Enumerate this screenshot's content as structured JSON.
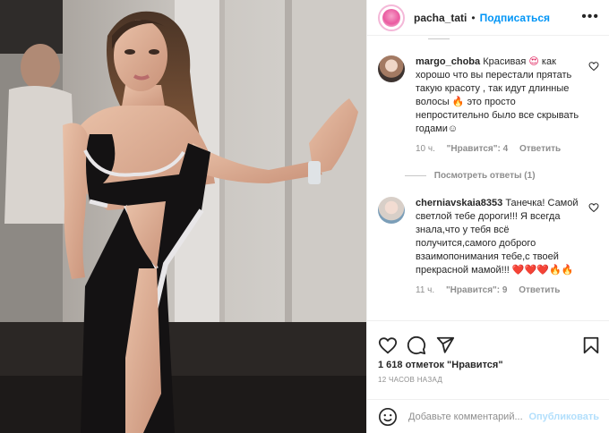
{
  "header": {
    "username": "pacha_tati",
    "separator": "•",
    "follow_label": "Подписаться"
  },
  "top_reply": {
    "text": ""
  },
  "comments": [
    {
      "username": "margo_choba",
      "text_a": "Красивая",
      "emoji_a": "😍",
      "text_b": "как хорошо что вы перестали прятать такую красоту , так идут длинные волосы",
      "emoji_b": "🔥",
      "text_c": "это просто непростительно было все скрывать годами☺",
      "time": "10 ч.",
      "likes": "\"Нравится\": 4",
      "reply": "Ответить",
      "view_replies": "Посмотреть ответы (1)"
    },
    {
      "username": "cherniavskaia8353",
      "text_a": "Танечка! Самой светлой тебе дороги!!! Я всегда знала,что у тебя всё получится,самого доброго взаимопонимания тебе,с твоей прекрасной мамой!!!",
      "emoji_a": "❤️❤️❤️🔥🔥",
      "time": "11 ч.",
      "likes": "\"Нравится\": 9",
      "reply": "Ответить"
    }
  ],
  "likes_count": "1 618 отметок \"Нравится\"",
  "post_time": "12 ЧАСОВ НАЗАД",
  "add_comment": {
    "placeholder": "Добавьте комментарий...",
    "publish_label": "Опубликовать"
  },
  "icons": [
    "more-icon",
    "heart-icon",
    "comment-icon",
    "share-icon",
    "bookmark-icon",
    "emoji-icon"
  ]
}
